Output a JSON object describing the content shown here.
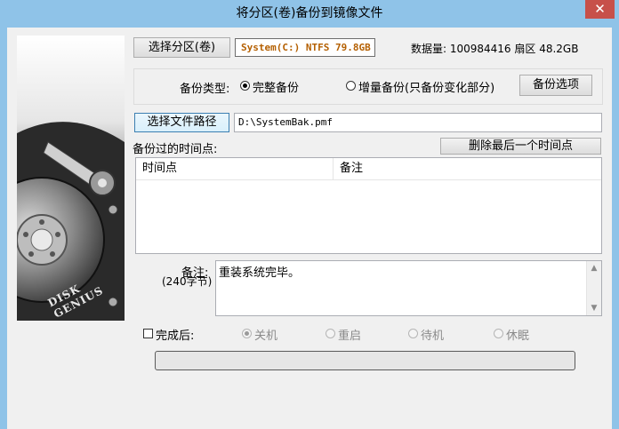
{
  "window": {
    "title": "将分区(卷)备份到镜像文件",
    "close_label": "✕"
  },
  "disk_image": {
    "brand": "DISK GENIUS"
  },
  "partition": {
    "select_button": "选择分区(卷)",
    "selected": "System(C:) NTFS 79.8GB",
    "data_amount_label": "数据量: 100984416 扇区  48.2GB"
  },
  "backup_type": {
    "label": "备份类型:",
    "full_label": "完整备份",
    "incremental_label": "增量备份(只备份变化部分)",
    "selected": "full",
    "options_button": "备份选项"
  },
  "file": {
    "select_button": "选择文件路径",
    "path": "D:\\SystemBak.pmf"
  },
  "timepoints": {
    "label": "备份过的时间点:",
    "delete_button": "删除最后一个时间点",
    "columns": [
      "时间点",
      "备注"
    ],
    "rows": []
  },
  "remark": {
    "label": "备注:",
    "limit": "(240字节)",
    "value": "重装系统完毕。"
  },
  "completion": {
    "checkbox_label": "完成后:",
    "checked": false,
    "options": [
      {
        "label": "关机",
        "selected": true
      },
      {
        "label": "重启",
        "selected": false
      },
      {
        "label": "待机",
        "selected": false
      },
      {
        "label": "休眠",
        "selected": false
      }
    ]
  },
  "progress": {
    "value": 0
  }
}
